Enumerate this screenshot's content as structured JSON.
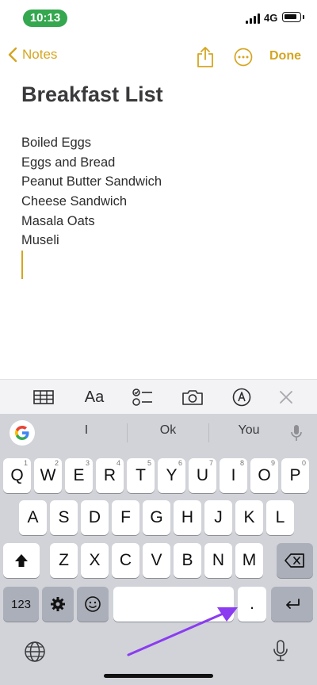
{
  "status_bar": {
    "time": "10:13",
    "network": "4G"
  },
  "nav": {
    "back_label": "Notes",
    "done_label": "Done",
    "accent_color": "#d5a521"
  },
  "note": {
    "title": "Breakfast List",
    "lines": [
      "Boiled Eggs",
      "Eggs and Bread",
      "Peanut Butter Sandwich",
      "Cheese Sandwich",
      "Masala Oats",
      "Museli"
    ]
  },
  "toolbar": {
    "items": [
      "table-icon",
      "Aa",
      "checklist-icon",
      "camera-icon",
      "markup-icon",
      "close-icon"
    ]
  },
  "keyboard": {
    "suggestions": [
      "I",
      "Ok",
      "You"
    ],
    "row1": [
      {
        "label": "Q",
        "num": "1"
      },
      {
        "label": "W",
        "num": "2"
      },
      {
        "label": "E",
        "num": "3"
      },
      {
        "label": "R",
        "num": "4"
      },
      {
        "label": "T",
        "num": "5"
      },
      {
        "label": "Y",
        "num": "6"
      },
      {
        "label": "U",
        "num": "7"
      },
      {
        "label": "I",
        "num": "8"
      },
      {
        "label": "O",
        "num": "9"
      },
      {
        "label": "P",
        "num": "0"
      }
    ],
    "row2": [
      "A",
      "S",
      "D",
      "F",
      "G",
      "H",
      "J",
      "K",
      "L"
    ],
    "row3": [
      "Z",
      "X",
      "C",
      "V",
      "B",
      "N",
      "M"
    ],
    "numbers_label": "123",
    "period_label": "."
  }
}
